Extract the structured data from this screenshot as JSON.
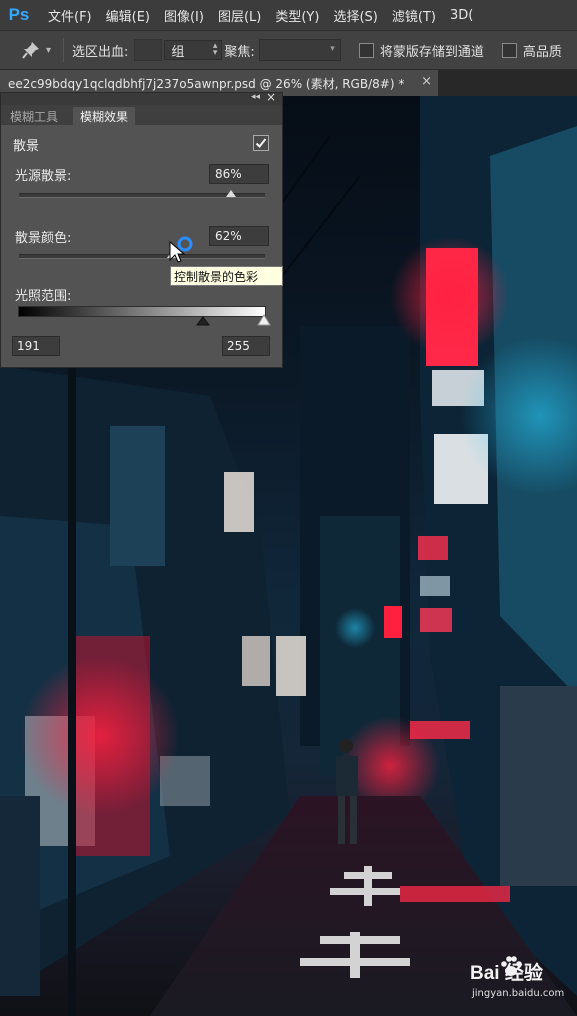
{
  "app": {
    "logo_text": "Ps"
  },
  "menu": [
    "文件(F)",
    "编辑(E)",
    "图像(I)",
    "图层(L)",
    "类型(Y)",
    "选择(S)",
    "滤镜(T)",
    "3D("
  ],
  "options_bar": {
    "selection_bleed_label": "选区出血:",
    "mode_value": "组",
    "focus_label": "聚焦:",
    "save_mask_label": "将蒙版存储到通道",
    "high_quality_label": "高品质"
  },
  "document_tab": {
    "title": "ee2c99bdqy1qclqdbhfj7j237o5awnpr.psd @ 26% (素材, RGB/8#) *",
    "close_symbol": "×"
  },
  "blur_panel": {
    "tabs": [
      "模糊工具",
      "模糊效果"
    ],
    "active_tab": "模糊效果",
    "bokeh_label": "散景",
    "bokeh_checked": true,
    "light_bokeh_label": "光源散景:",
    "light_bokeh_value": "86%",
    "light_bokeh_fraction": 0.86,
    "bokeh_color_label": "散景颜色:",
    "bokeh_color_value": "62%",
    "bokeh_color_fraction": 0.62,
    "light_range_label": "光照范围:",
    "light_range_low": "191",
    "light_range_high": "255",
    "tooltip": "控制散景的色彩"
  },
  "watermark": {
    "brand": "Bai 经验",
    "site": "jingyan.baidu.com"
  }
}
